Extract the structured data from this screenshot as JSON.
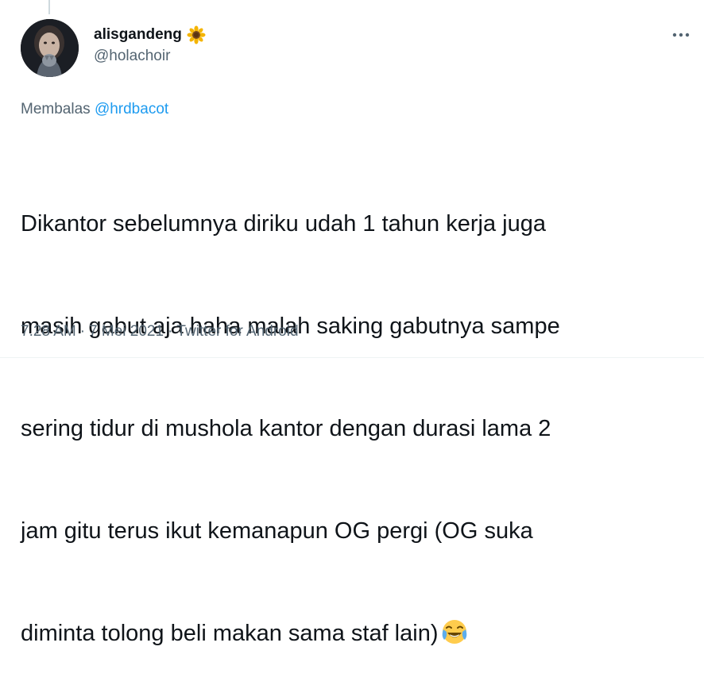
{
  "author": {
    "display_name": "alisgandeng",
    "name_emoji": "sunflower-icon",
    "handle": "@holachoir"
  },
  "reply": {
    "prefix": "Membalas",
    "mention": "@hrdbacot"
  },
  "tweet": {
    "lines": [
      "Dikantor sebelumnya diriku udah 1 tahun kerja juga",
      "masih gabut aja haha malah saking gabutnya sampe",
      "sering tidur di mushola kantor dengan durasi lama 2",
      "jam gitu terus ikut kemanapun OG pergi (OG suka",
      "diminta tolong beli makan sama staf lain)"
    ],
    "trailing_emoji": "face-with-tears-of-joy-icon"
  },
  "meta": {
    "time": "7.28 AM",
    "separator": "·",
    "date": "7 Mei 2021",
    "source": "Twitter for Android"
  },
  "colors": {
    "text": "#0f1419",
    "secondary": "#536471",
    "link": "#1d9bf0"
  }
}
